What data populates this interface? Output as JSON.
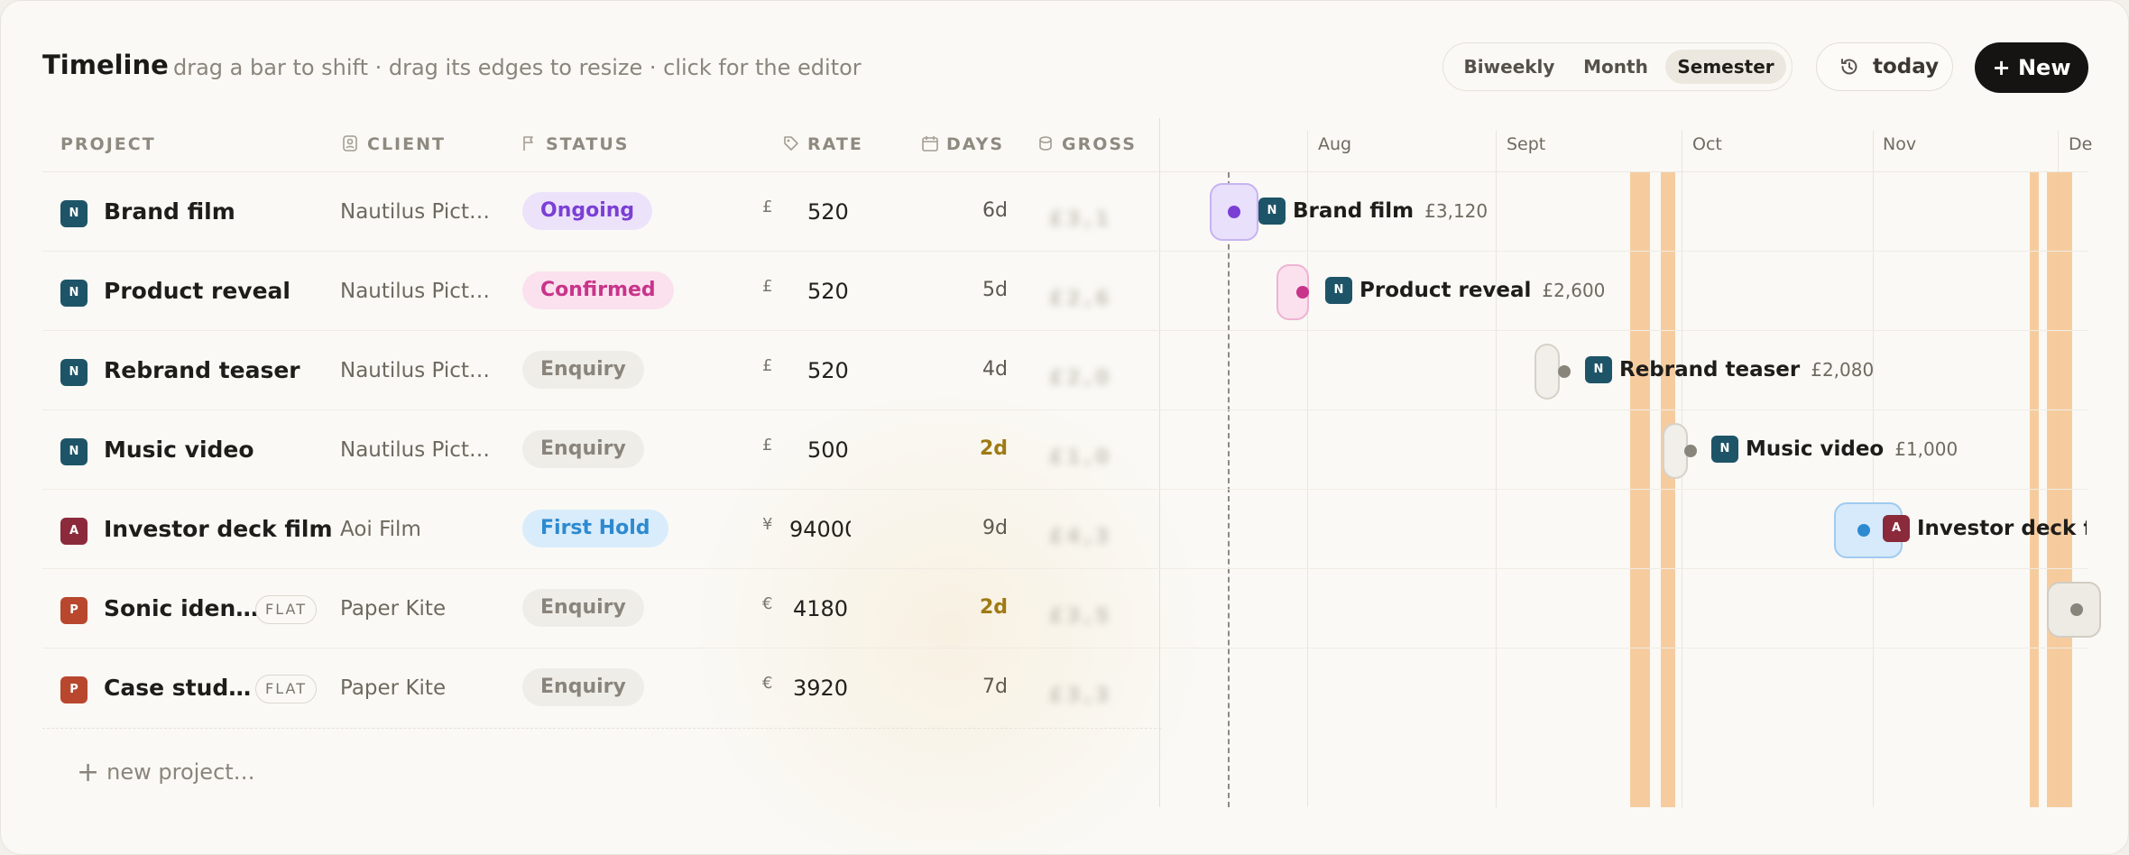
{
  "header": {
    "title": "Timeline",
    "hint": "drag a bar to shift · drag its edges to resize · click for the editor"
  },
  "view_toggle": {
    "options": [
      "Biweekly",
      "Month",
      "Semester"
    ],
    "selected": "Semester"
  },
  "today_button": "today",
  "new_button": "+ New",
  "columns": {
    "project": "PROJECT",
    "client": "CLIENT",
    "status": "STATUS",
    "rate": "RATE",
    "days": "DAYS",
    "gross": "GROSS"
  },
  "months": [
    "Aug",
    "Sept",
    "Oct",
    "Nov",
    "De"
  ],
  "rows": [
    {
      "badge": "N",
      "badge_color": "#1e5467",
      "name": "Brand film",
      "flat": "",
      "client": "Nautilus Pict…",
      "status": "Ongoing",
      "currency": "£",
      "rate": "520",
      "days": "6d",
      "days_warn": false,
      "gross": "£3,1",
      "bar_price": "£3,120"
    },
    {
      "badge": "N",
      "badge_color": "#1e5467",
      "name": "Product reveal",
      "flat": "",
      "client": "Nautilus Pict…",
      "status": "Confirmed",
      "currency": "£",
      "rate": "520",
      "days": "5d",
      "days_warn": false,
      "gross": "£2,6",
      "bar_price": "£2,600"
    },
    {
      "badge": "N",
      "badge_color": "#1e5467",
      "name": "Rebrand teaser",
      "flat": "",
      "client": "Nautilus Pict…",
      "status": "Enquiry",
      "currency": "£",
      "rate": "520",
      "days": "4d",
      "days_warn": false,
      "gross": "£2,0",
      "bar_price": "£2,080"
    },
    {
      "badge": "N",
      "badge_color": "#1e5467",
      "name": "Music video",
      "flat": "",
      "client": "Nautilus Pict…",
      "status": "Enquiry",
      "currency": "£",
      "rate": "500",
      "days": "2d",
      "days_warn": true,
      "gross": "£1,0",
      "bar_price": "£1,000"
    },
    {
      "badge": "A",
      "badge_color": "#8a2a3b",
      "name": "Investor deck film",
      "flat": "",
      "client": "Aoi Film",
      "status": "First Hold",
      "currency": "¥",
      "rate": "94000",
      "days": "9d",
      "days_warn": false,
      "gross": "£4,3",
      "bar_price": ""
    },
    {
      "badge": "P",
      "badge_color": "#b8472e",
      "name": "Sonic iden…",
      "flat": "FLAT",
      "client": "Paper Kite",
      "status": "Enquiry",
      "currency": "€",
      "rate": "4180",
      "days": "2d",
      "days_warn": true,
      "gross": "£3,5",
      "bar_price": ""
    },
    {
      "badge": "P",
      "badge_color": "#b8472e",
      "name": "Case stud…",
      "flat": "FLAT",
      "client": "Paper Kite",
      "status": "Enquiry",
      "currency": "€",
      "rate": "3920",
      "days": "7d",
      "days_warn": false,
      "gross": "£3,3",
      "bar_price": ""
    }
  ],
  "timeline_labels": {
    "r0": "Brand film",
    "r1": "Product reveal",
    "r2": "Rebrand teaser",
    "r3": "Music video",
    "r4": "Investor deck film"
  },
  "new_project": "new project…",
  "status_colors": {
    "Ongoing": "#7b3fd4",
    "Confirmed": "#c8348a",
    "Enquiry": "#8a857c",
    "First Hold": "#2d8ad0"
  }
}
